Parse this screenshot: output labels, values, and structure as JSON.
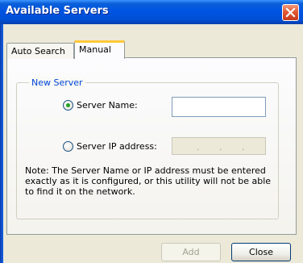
{
  "window": {
    "title": "Available Servers"
  },
  "tabs": [
    {
      "label": "Auto Search",
      "active": false
    },
    {
      "label": "Manual",
      "active": true
    }
  ],
  "group": {
    "legend": "New Server",
    "server_name": {
      "label": "Server Name:",
      "selected": true,
      "value": ""
    },
    "server_ip": {
      "label": "Server IP address:",
      "selected": false,
      "enabled": false,
      "separators": [
        ".",
        ".",
        "."
      ]
    },
    "note": "Note:  The Server Name or IP address must be entered exactly as it is configured, or this utility will not be able to find it on the network."
  },
  "buttons": {
    "add": {
      "label": "Add",
      "enabled": false
    },
    "close": {
      "label": "Close",
      "enabled": true
    }
  },
  "colors": {
    "titlebar": "#0054e3",
    "close_button": "#e35a33",
    "active_tab_accent": "#ffc83c",
    "group_legend": "#0046d5",
    "radio_dot": "#21a121"
  },
  "icons": {
    "close": "close-icon"
  }
}
